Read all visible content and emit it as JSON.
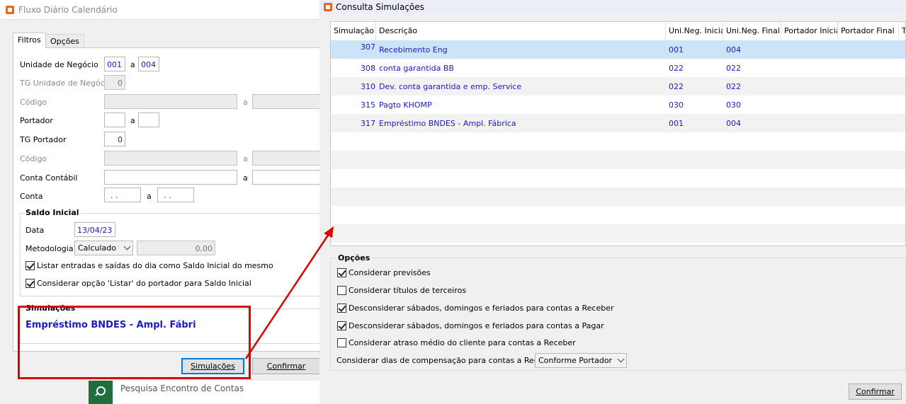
{
  "left_window": {
    "title": "Fluxo Diário Calendário",
    "tabs": [
      "Filtros",
      "Opções"
    ],
    "fields": {
      "unidade_label": "Unidade de Negócio",
      "unidade_from": "001",
      "unidade_to": "004",
      "tg_unidade_label": "TG Unidade de Negócio",
      "tg_unidade_value": "0",
      "codigo_label": "Código",
      "portador_label": "Portador",
      "tg_portador_label": "TG Portador",
      "tg_portador_value": "0",
      "codigo2_label": "Código",
      "conta_contabil_label": "Conta Contábil",
      "conta_label": "Conta",
      "conta_from": ". .",
      "conta_to": ". .",
      "sep_a": "a"
    },
    "saldo_inicial": {
      "title": "Saldo Inicial",
      "data_label": "Data",
      "data_value": "13/04/23",
      "metodologia_label": "Metodologia",
      "metodologia_value": "Calculado",
      "amount": "0,00",
      "check1": "Listar entradas e saídas do dia como Saldo Inicial do mesmo",
      "check2": "Considerar opção 'Listar' do portador para Saldo Inicial"
    },
    "simulacoes": {
      "title": "Simulações",
      "value": "Empréstimo BNDES - Ampl. Fábri"
    },
    "buttons": {
      "simulacoes": "Simulações",
      "confirmar": "Confirmar"
    }
  },
  "taskbar": {
    "item_label": "Pesquisa Encontro de Contas"
  },
  "right_window": {
    "title": "Consulta Simulações",
    "columns": [
      "Simulação",
      "Descrição",
      "Uni.Neg. Inicial",
      "Uni.Neg. Final",
      "Portador Inicial",
      "Portador Final",
      "T"
    ],
    "rows": [
      {
        "id": "307",
        "desc": "Recebimento Eng",
        "uni_ini": "001",
        "uni_fin": "004"
      },
      {
        "id": "308",
        "desc": "conta garantida BB",
        "uni_ini": "022",
        "uni_fin": "022"
      },
      {
        "id": "310",
        "desc": "Dev. conta garantida e emp. Service",
        "uni_ini": "022",
        "uni_fin": "022"
      },
      {
        "id": "315",
        "desc": "Pagto KHOMP",
        "uni_ini": "030",
        "uni_fin": "030"
      },
      {
        "id": "317",
        "desc": "Empréstimo BNDES - Ampl. Fábrica",
        "uni_ini": "001",
        "uni_fin": "004"
      }
    ],
    "opcoes": {
      "title": "Opções",
      "checks": [
        {
          "label": "Considerar previsões",
          "checked": true
        },
        {
          "label": "Considerar títulos de terceiros",
          "checked": false
        },
        {
          "label": "Desconsiderar sábados, domingos e feriados para contas a Receber",
          "checked": true
        },
        {
          "label": "Desconsiderar sábados, domingos e feriados para contas a Pagar",
          "checked": true
        },
        {
          "label": "Considerar atraso médio do cliente para contas a Receber",
          "checked": false
        }
      ],
      "dias_label": "Considerar dias de compensação para contas a Receber",
      "dias_value": "Conforme Portador"
    },
    "confirmar": "Confirmar"
  },
  "colors": {
    "accent_red": "#e00000",
    "value_blue": "#1a1acc",
    "selection": "#cce4f7",
    "app_icon": "#e8661c"
  }
}
